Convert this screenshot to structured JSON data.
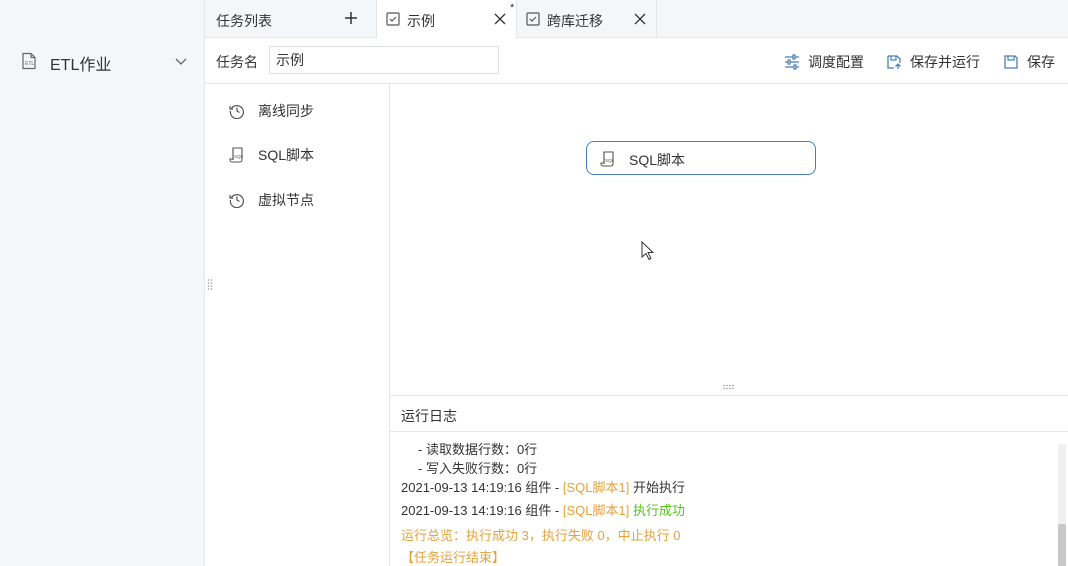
{
  "sidebar": {
    "item_label": "ETL作业"
  },
  "tabs": {
    "list_label": "任务列表",
    "example_label": "示例",
    "example_modified": "*",
    "cross_label": "跨库迁移"
  },
  "toolbar": {
    "name_label": "任务名",
    "name_value": "示例",
    "schedule_label": "调度配置",
    "save_run_label": "保存并运行",
    "save_label": "保存"
  },
  "palette": {
    "items": [
      "离线同步",
      "SQL脚本",
      "虚拟节点"
    ]
  },
  "canvas": {
    "node_label": "SQL脚本"
  },
  "log": {
    "title": "运行日志",
    "line1": "- 读取数据行数：0行",
    "line2": "- 写入失败行数：0行",
    "line3_prefix": "2021-09-13 14:19:16 组件 - ",
    "line3_component": "[SQL脚本1]",
    "line3_status": " 开始执行",
    "line4_prefix": "2021-09-13 14:19:16 组件 - ",
    "line4_component": "[SQL脚本1]",
    "line4_status": " 执行成功",
    "summary": "运行总览：执行成功 3，执行失败 0，中止执行 0",
    "end": "【任务运行结束】"
  },
  "colors": {
    "accent": "#4a7ebb",
    "warning": "#e6a23c",
    "success": "#52c41a"
  }
}
